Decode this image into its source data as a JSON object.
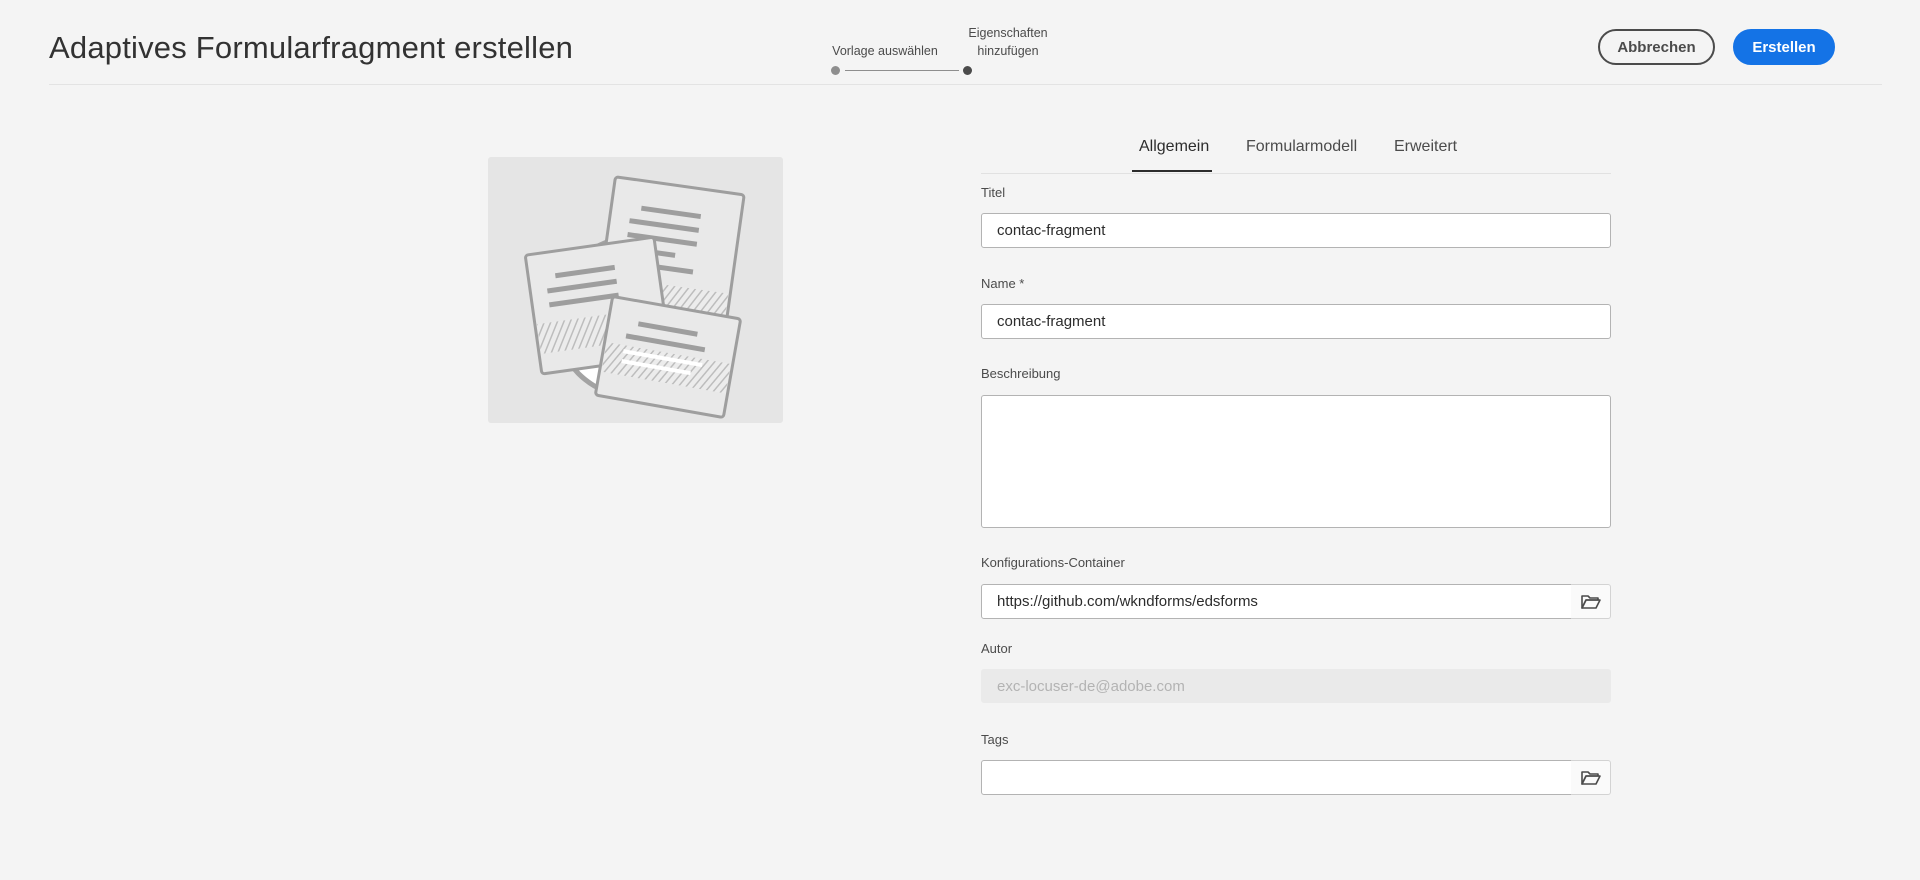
{
  "header": {
    "title": "Adaptives Formularfragment erstellen",
    "steps": [
      {
        "label": "Vorlage auswählen",
        "state": "completed"
      },
      {
        "label_line1": "Eigenschaften",
        "label_line2": "hinzufügen",
        "state": "current"
      }
    ],
    "cancel_label": "Abbrechen",
    "create_label": "Erstellen"
  },
  "tabs": [
    {
      "label": "Allgemein",
      "active": true
    },
    {
      "label": "Formularmodell",
      "active": false
    },
    {
      "label": "Erweitert",
      "active": false
    }
  ],
  "form": {
    "title": {
      "label": "Titel",
      "value": "contac-fragment"
    },
    "name": {
      "label": "Name *",
      "value": "contac-fragment"
    },
    "description": {
      "label": "Beschreibung",
      "value": ""
    },
    "config_container": {
      "label": "Konfigurations-Container",
      "value": "https://github.com/wkndforms/edsforms"
    },
    "author": {
      "label": "Autor",
      "value": "exc-locuser-de@adobe.com"
    },
    "tags": {
      "label": "Tags",
      "value": ""
    }
  },
  "colors": {
    "accent": "#1473e6",
    "background": "#f4f4f4"
  }
}
